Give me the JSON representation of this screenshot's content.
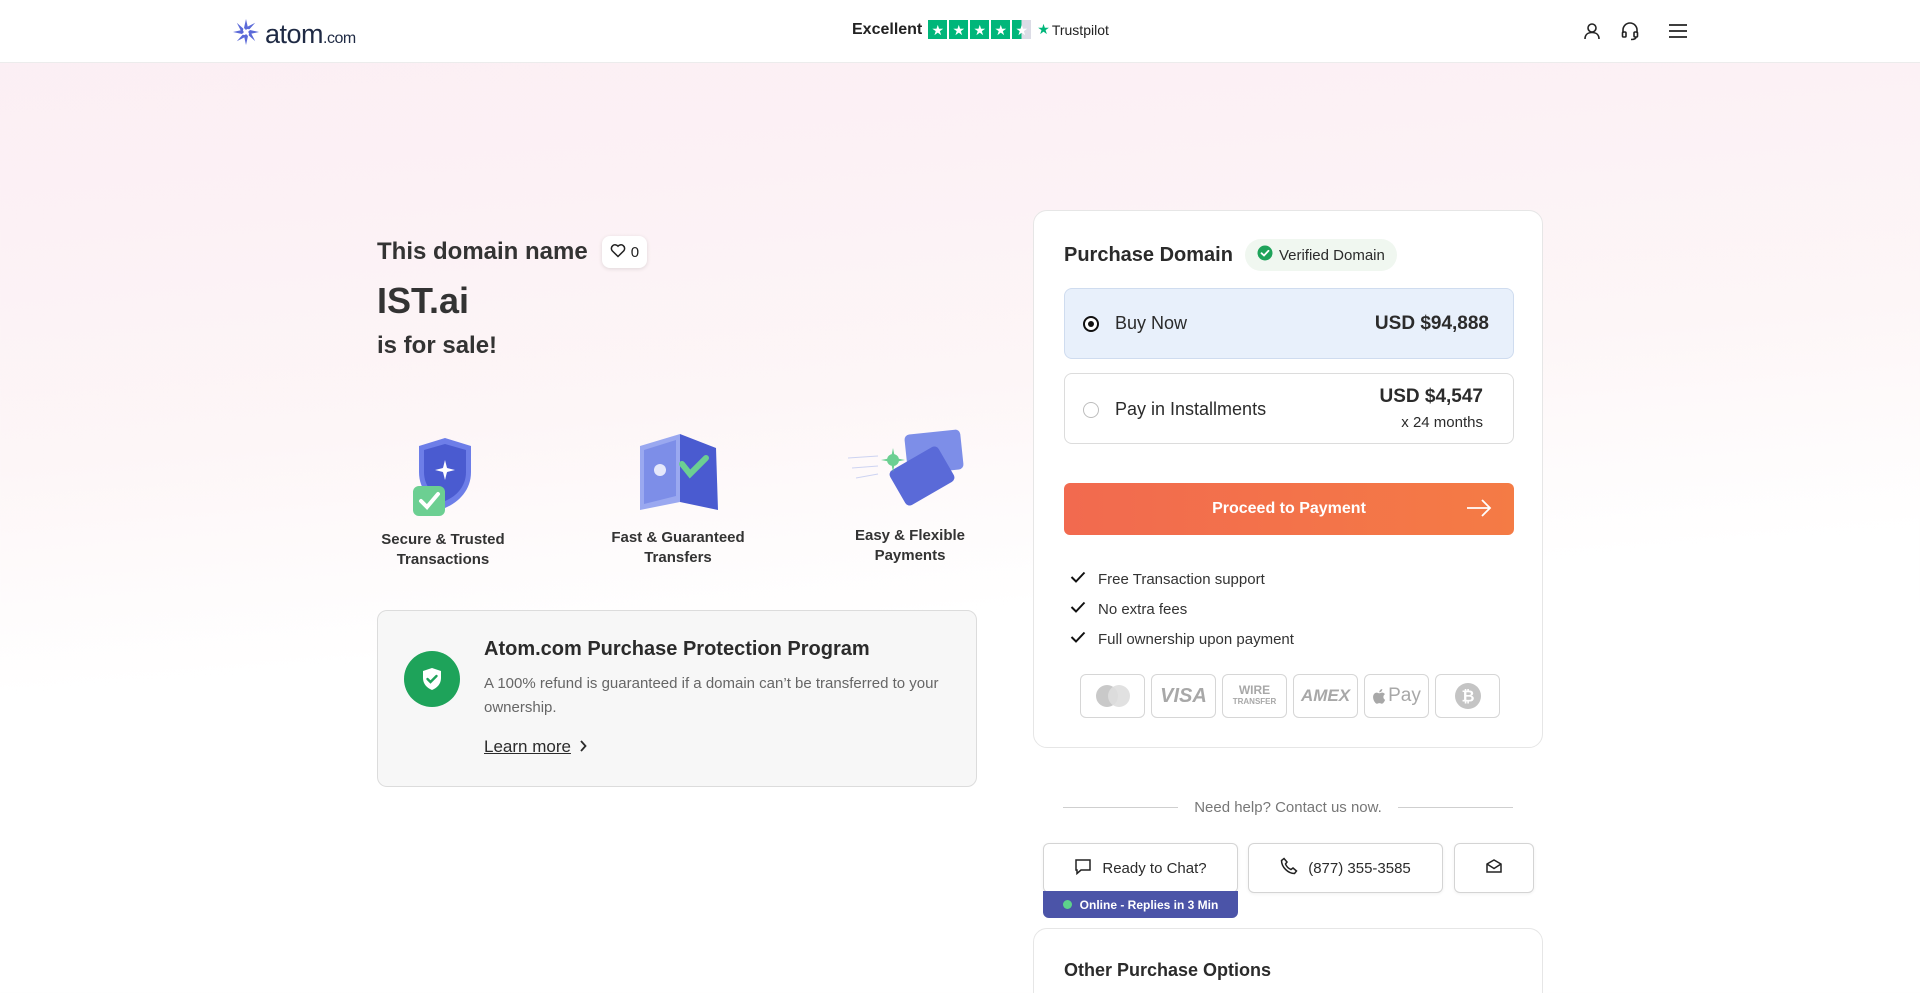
{
  "header": {
    "logo_main": "atom",
    "logo_suffix": ".com",
    "trust_label": "Excellent",
    "trust_brand": "Trustpilot",
    "trust_rating_stars": 4.5,
    "icons": [
      "user-icon",
      "headset-icon",
      "menu-icon"
    ]
  },
  "hero": {
    "pre_title": "This domain name",
    "favorite_count": "0",
    "domain": "IST.ai",
    "post_title": "is for sale!"
  },
  "features": [
    {
      "label_line1": "Secure & Trusted",
      "label_line2": "Transactions"
    },
    {
      "label_line1": "Fast & Guaranteed",
      "label_line2": "Transfers"
    },
    {
      "label_line1": "Easy & Flexible",
      "label_line2": "Payments"
    }
  ],
  "protection": {
    "title": "Atom.com Purchase Protection Program",
    "description": "A 100% refund is guaranteed if a domain can’t be transferred to your ownership.",
    "link": "Learn more"
  },
  "purchase": {
    "title": "Purchase Domain",
    "verified_label": "Verified Domain",
    "options": [
      {
        "label": "Buy Now",
        "price": "USD $94,888",
        "selected": true
      },
      {
        "label": "Pay in Installments",
        "price": "USD $4,547",
        "sub": "x 24 months",
        "selected": false
      }
    ],
    "proceed_label": "Proceed to Payment",
    "perks": [
      "Free Transaction support",
      "No extra fees",
      "Full ownership upon payment"
    ],
    "payment_methods": [
      "mastercard-icon",
      "visa-icon",
      "wire-transfer-icon",
      "amex-icon",
      "apple-pay-icon",
      "bitcoin-icon"
    ],
    "payment_text": {
      "visa": "VISA",
      "wire_top": "WIRE",
      "wire_bottom": "TRANSFER",
      "amex": "AMEX",
      "apple_pay": "Pay"
    }
  },
  "help": {
    "text": "Need help? Contact us now.",
    "chat_label": "Ready to Chat?",
    "phone": "(877) 355-3585",
    "online_status": "Online - Replies in 3 Min"
  },
  "other_options": {
    "title": "Other Purchase Options"
  },
  "colors": {
    "accent_orange": "#f26a4f",
    "trust_green": "#00b67a",
    "verified_green": "#1ea35a",
    "online_bar": "#4b54a8"
  }
}
